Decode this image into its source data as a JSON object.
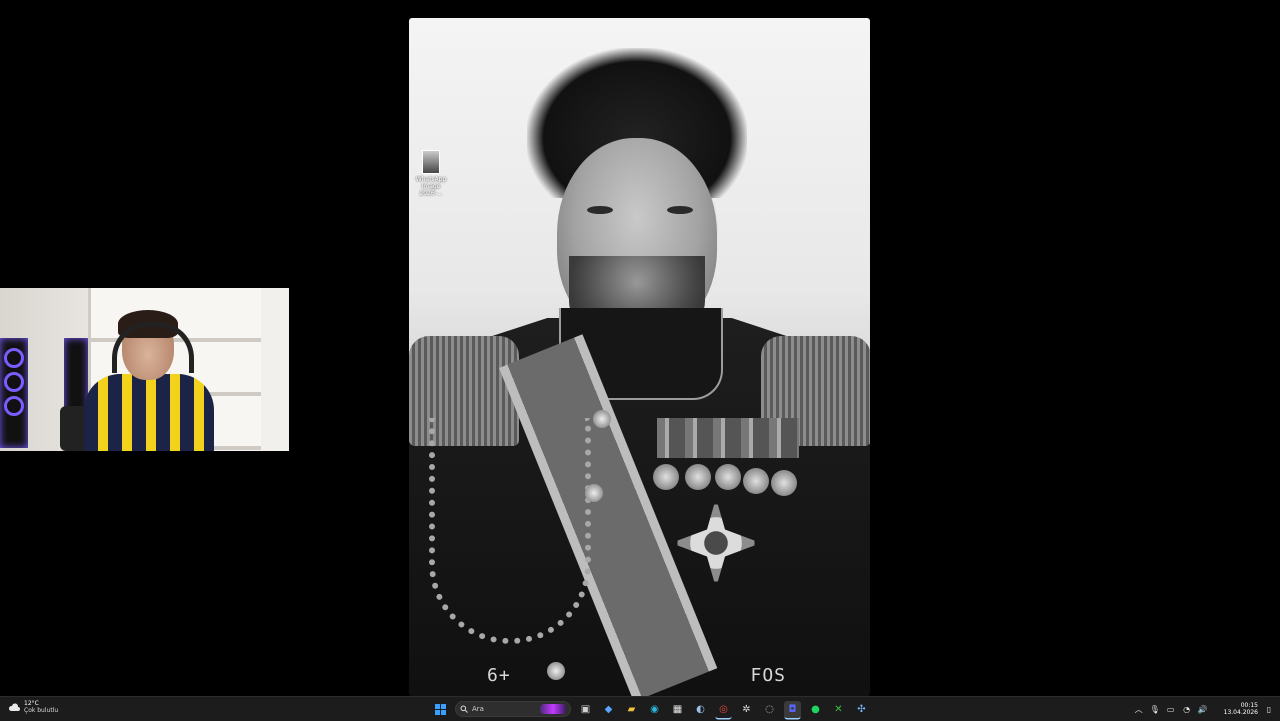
{
  "desktop": {
    "icon": {
      "label": "WhatsApp Image 2026-..."
    },
    "wallpaper": {
      "film_left": "6+",
      "film_right": "FOS"
    }
  },
  "taskbar": {
    "weather": {
      "temperature": "12°C",
      "condition": "Çok bulutlu",
      "icon": "cloud-icon"
    },
    "search": {
      "placeholder": "Ara"
    },
    "apps": [
      {
        "name": "task-view-icon",
        "color": "#d0d0d0"
      },
      {
        "name": "copilot-icon",
        "color": "#5aa6ff"
      },
      {
        "name": "file-explorer-icon",
        "color": "#f3c23c"
      },
      {
        "name": "edge-icon",
        "color": "#2bb3d8"
      },
      {
        "name": "store-icon",
        "color": "#e8e8e8"
      },
      {
        "name": "steam-icon",
        "color": "#9fc3e8"
      },
      {
        "name": "chrome-icon",
        "color": "#e24a3b"
      },
      {
        "name": "settings-icon",
        "color": "#d8d8d8"
      },
      {
        "name": "obs-icon",
        "color": "#cfcfcf"
      },
      {
        "name": "discord-icon",
        "color": "#5865f2"
      },
      {
        "name": "spotify-icon",
        "color": "#1ed760"
      },
      {
        "name": "xbox-icon",
        "color": "#3fbf3f"
      },
      {
        "name": "network-app-icon",
        "color": "#7bb6ff"
      }
    ],
    "tray": {
      "items": [
        "chevron-up-icon",
        "microphone-icon",
        "display-icon",
        "wifi-icon",
        "volume-icon"
      ],
      "time": "00:15",
      "date": "13.04.2026"
    }
  }
}
